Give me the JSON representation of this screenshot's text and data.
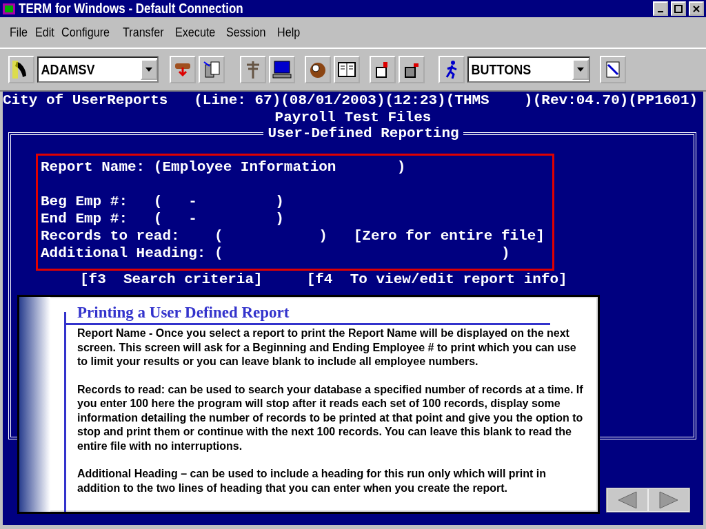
{
  "window": {
    "title": "TERM for Windows - Default Connection"
  },
  "menu": [
    {
      "label": "File"
    },
    {
      "label": "Edit"
    },
    {
      "label": "Configure"
    },
    {
      "label": "Transfer"
    },
    {
      "label": "Execute"
    },
    {
      "label": "Session"
    },
    {
      "label": "Help"
    }
  ],
  "toolbar": {
    "session_select": "ADAMSV",
    "buttons_select": "BUTTONS"
  },
  "terminal": {
    "status_line": "City of UserReports   (Line: 67)(08/01/2003)(12:23)(THMS    )(Rev:04.70)(PP1601)",
    "subtitle": "Payroll Test Files",
    "frame_title": "User-Defined Reporting",
    "report_name": "Report Name: (Employee Information       )",
    "lines": [
      "Beg Emp #:   (   -         )",
      "End Emp #:   (   -         )",
      "Records to read:    (           )   [Zero for entire file]",
      "Additional Heading: (                                )"
    ],
    "function_keys": [
      "[f3  Search criteria]",
      "[f4  To view/edit report info]"
    ]
  },
  "popup": {
    "title": "Printing a User Defined Report",
    "paragraphs": [
      "Report Name - Once you select a report to print the Report Name will be displayed on the next screen.  This screen will ask for a Beginning and Ending Employee # to print which you can use to limit your results or you can leave blank to include all employee numbers.",
      "Records to read: can be used to search your database a specified number of records at a time.  If you enter 100 here the program will stop after it reads each set of 100 records, display some information detailing the number of records to be printed at that point and give you the option to stop and print them or continue with the next 100 records.  You can leave this blank to read the entire file with no interruptions.",
      "Additional Heading – can be used to include a heading for this run only which will print in addition to the two lines of heading that you can enter when you create the report."
    ]
  }
}
